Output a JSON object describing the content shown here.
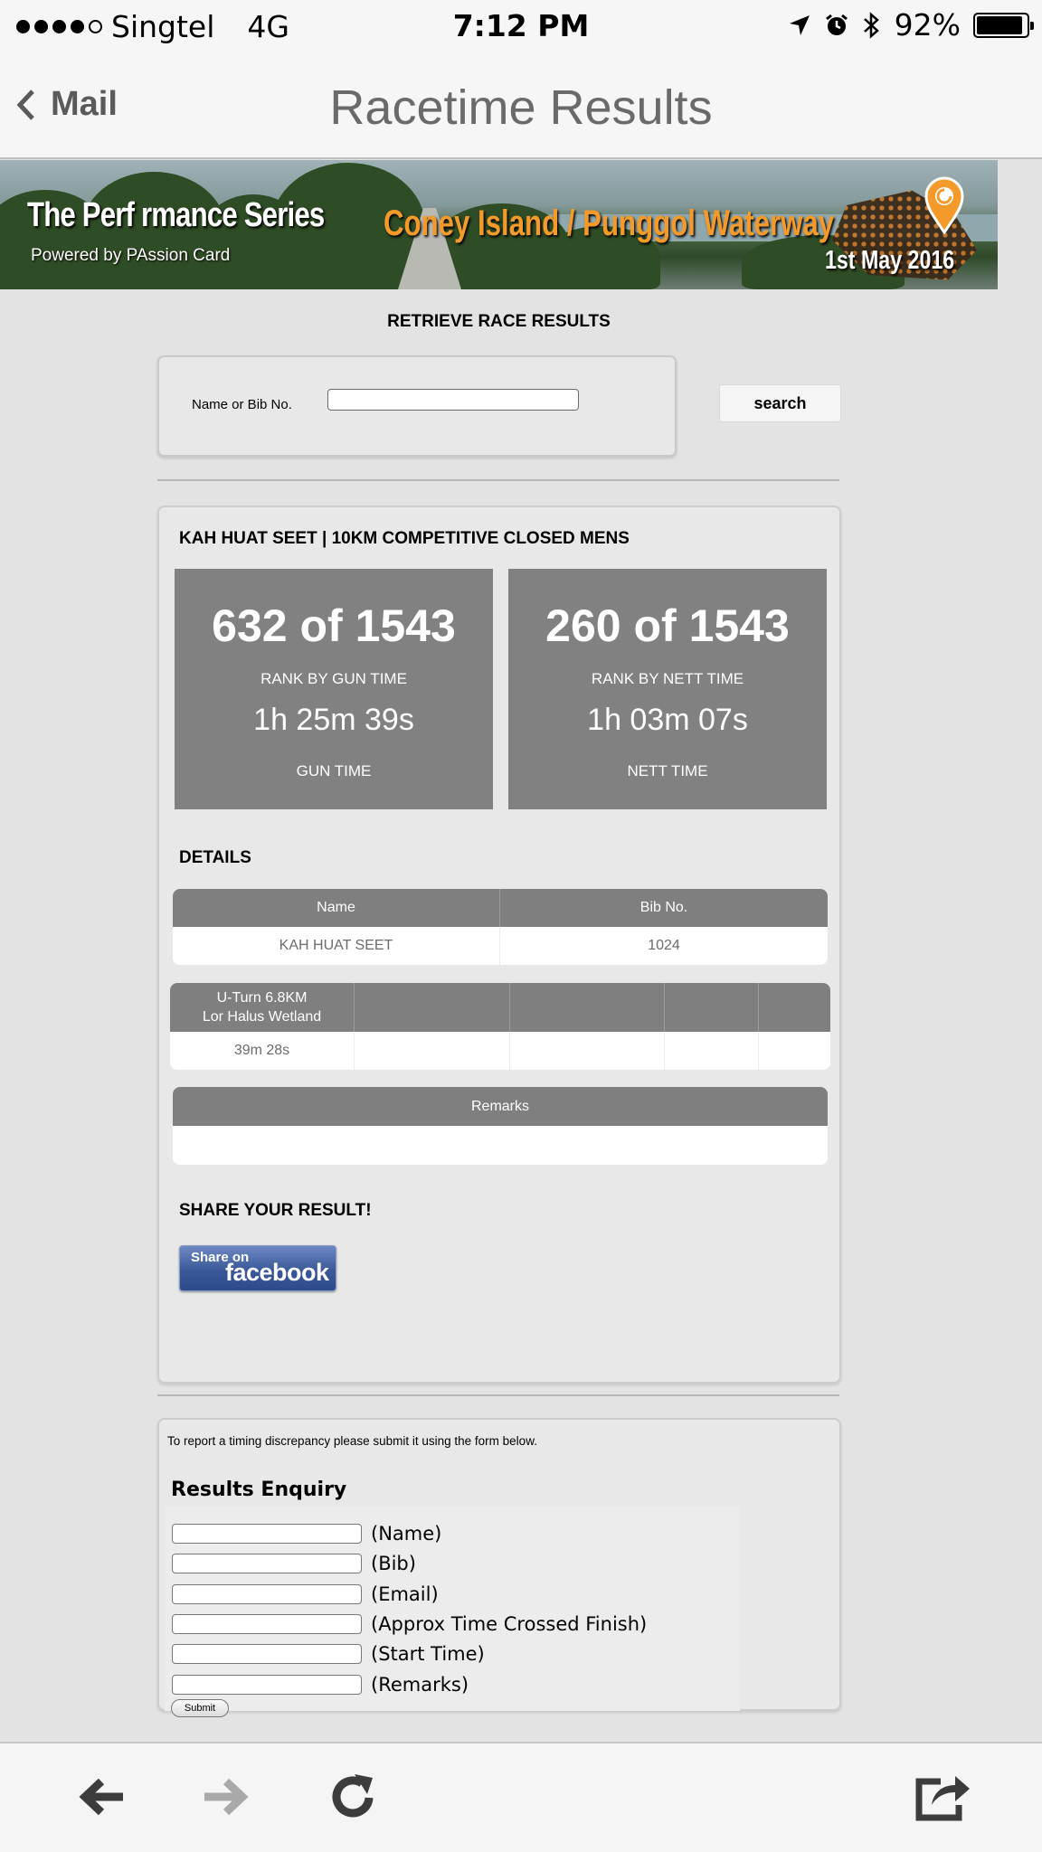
{
  "status_bar": {
    "carrier": "Singtel",
    "network": "4G",
    "time": "7:12 PM",
    "battery": "92%",
    "battery_level": 0.92
  },
  "nav": {
    "back_label": "Mail",
    "title": "Racetime Results"
  },
  "banner": {
    "series_name": "The Perf  rmance Series",
    "powered_by": "Powered by PAssion Card",
    "event_name": "Coney Island / Punggol Waterway",
    "date": "1st May 2016"
  },
  "search": {
    "title": "RETRIEVE RACE RESULTS",
    "field_label": "Name or Bib No.",
    "value": "",
    "placeholder": "",
    "button_label": "search"
  },
  "result": {
    "heading": "KAH HUAT SEET | 10KM COMPETITIVE CLOSED MENS",
    "gun": {
      "rank": "632 of 1543",
      "rank_label": "RANK BY GUN TIME",
      "time": "1h 25m 39s",
      "time_label": "GUN TIME"
    },
    "nett": {
      "rank": "260 of 1543",
      "rank_label": "RANK BY NETT TIME",
      "time": "1h 03m 07s",
      "time_label": "NETT TIME"
    },
    "details_title": "DETAILS",
    "details_table": {
      "headers": [
        "Name",
        "Bib No."
      ],
      "row": [
        "KAH HUAT SEET",
        "1024"
      ]
    },
    "splits_table": {
      "header_line1": "U-Turn 6.8KM",
      "header_line2": "Lor Halus Wetland",
      "value": "39m 28s"
    },
    "remarks_table": {
      "header": "Remarks",
      "value": ""
    },
    "share_title": "SHARE YOUR RESULT!",
    "facebook": {
      "share_on": "Share on",
      "brand": "facebook"
    }
  },
  "enquiry": {
    "note": "To report a timing discrepancy please submit it using the form below.",
    "title": "Results Enquiry",
    "fields": [
      {
        "label": "(Name)",
        "value": ""
      },
      {
        "label": "(Bib)",
        "value": ""
      },
      {
        "label": "(Email)",
        "value": ""
      },
      {
        "label": "(Approx Time Crossed Finish)",
        "value": ""
      },
      {
        "label": "(Start Time)",
        "value": ""
      },
      {
        "label": "(Remarks)",
        "value": ""
      }
    ],
    "submit_label": "Submit"
  },
  "toolbar": {
    "icons": [
      "back-arrow-icon",
      "forward-arrow-icon",
      "reload-icon",
      "share-icon"
    ]
  }
}
